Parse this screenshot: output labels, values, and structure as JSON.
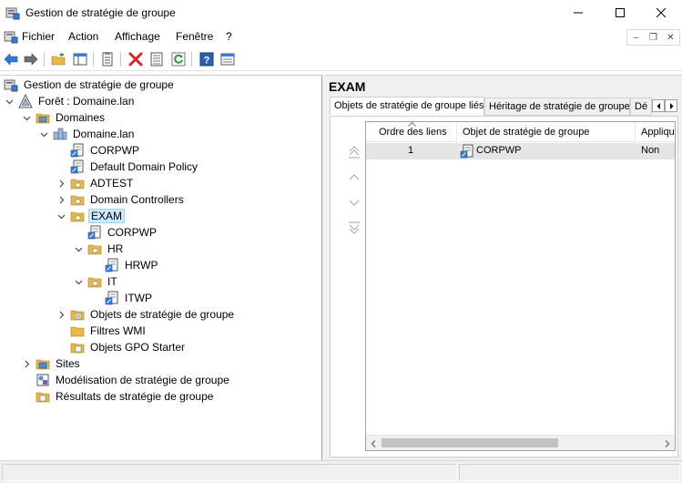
{
  "window": {
    "title": "Gestion de stratégie de groupe",
    "app_icon": "gpmc-app-icon",
    "controls": {
      "minimize": "minimize-icon",
      "maximize": "maximize-icon",
      "close": "close-icon"
    }
  },
  "menubar": {
    "items": [
      "Fichier",
      "Action",
      "Affichage",
      "Fenêtre",
      "?"
    ]
  },
  "toolbar": {
    "buttons": [
      "back-arrow-icon",
      "forward-arrow-icon",
      "up-folder-icon",
      "show-hide-tree-icon",
      "properties-icon",
      "delete-icon",
      "export-list-icon",
      "refresh-icon",
      "help-icon",
      "details-view-icon"
    ]
  },
  "tree": {
    "root": "Gestion de stratégie de groupe",
    "forest": "Forêt : Domaine.lan",
    "domains": "Domaines",
    "domain": "Domaine.lan",
    "corpwp": "CORPWP",
    "default_policy": "Default Domain Policy",
    "adtest": "ADTEST",
    "domain_controllers": "Domain Controllers",
    "exam": "EXAM",
    "exam_corpwp": "CORPWP",
    "hr": "HR",
    "hrwp": "HRWP",
    "it": "IT",
    "itwp": "ITWP",
    "gpo_objects": "Objets de stratégie de groupe",
    "wmi_filters": "Filtres WMI",
    "starter_gpos": "Objets GPO Starter",
    "sites": "Sites",
    "modeling": "Modélisation de stratégie de groupe",
    "results": "Résultats de stratégie de groupe"
  },
  "details": {
    "title": "EXAM",
    "tabs": [
      "Objets de stratégie de groupe liés",
      "Héritage de stratégie de groupe",
      "Dé"
    ],
    "active_tab": 0,
    "columns": [
      "Ordre des liens",
      "Objet de stratégie de groupe",
      "Appliqu"
    ],
    "rows": [
      {
        "order": "1",
        "gpo": "CORPWP",
        "enforced": "Non"
      }
    ]
  },
  "colors": {
    "selection": "#cce8ff",
    "selection_border": "#99d1ff",
    "folder": "#e8b94a",
    "accent_blue": "#1e5fb4",
    "delete_red": "#d8232a"
  }
}
